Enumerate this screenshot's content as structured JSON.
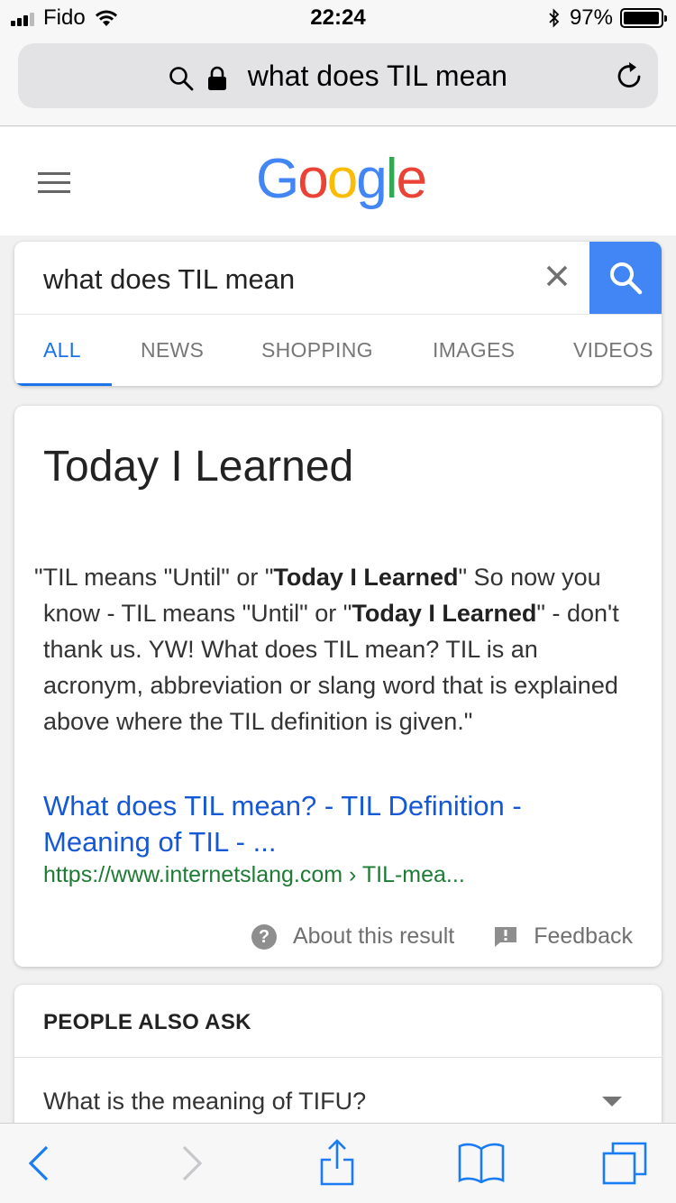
{
  "status_bar": {
    "carrier": "Fido",
    "time": "22:24",
    "battery_percent": "97%",
    "battery_level": 0.97
  },
  "safari": {
    "url_text": "what does TIL mean"
  },
  "google": {
    "logo_letters": [
      {
        "char": "G",
        "color": "#4285F4"
      },
      {
        "char": "o",
        "color": "#EA4335"
      },
      {
        "char": "o",
        "color": "#FBBC05"
      },
      {
        "char": "g",
        "color": "#4285F4"
      },
      {
        "char": "l",
        "color": "#34A853"
      },
      {
        "char": "e",
        "color": "#EA4335"
      }
    ],
    "search_query": "what does TIL mean",
    "tabs": [
      "ALL",
      "NEWS",
      "SHOPPING",
      "IMAGES",
      "VIDEOS"
    ],
    "active_tab": "ALL"
  },
  "answer": {
    "title": "Today I Learned",
    "snippet_parts": [
      {
        "text": "TIL means \"Until\" or \"",
        "bold": false
      },
      {
        "text": "Today I Learned",
        "bold": true
      },
      {
        "text": "\" So now you know - TIL means \"Until\" or \"",
        "bold": false
      },
      {
        "text": "Today I Learned",
        "bold": true
      },
      {
        "text": "\" - don't thank us. YW! What does TIL mean? TIL is an acronym, abbreviation or slang word that is explained above where the TIL definition is given.",
        "bold": false
      }
    ],
    "link_title": "What does TIL mean? - TIL Definition - Meaning of TIL - ...",
    "link_url": "https://www.internetslang.com › TIL-mea...",
    "about_label": "About this result",
    "feedback_label": "Feedback"
  },
  "people_also_ask": {
    "heading": "PEOPLE ALSO ASK",
    "questions": [
      "What is the meaning of TIFU?"
    ]
  },
  "colors": {
    "accent_blue": "#1a73e8",
    "search_button": "#4285f4",
    "link_blue": "#1558d6",
    "url_green": "#1e7b34"
  },
  "icons": {
    "status": [
      "signal-icon",
      "wifi-icon",
      "bluetooth-icon",
      "battery-icon"
    ],
    "safari_top": [
      "search-icon",
      "lock-icon",
      "reload-icon"
    ],
    "toolbar": [
      "back-icon",
      "forward-icon",
      "share-icon",
      "bookmarks-icon",
      "tabs-icon"
    ]
  }
}
